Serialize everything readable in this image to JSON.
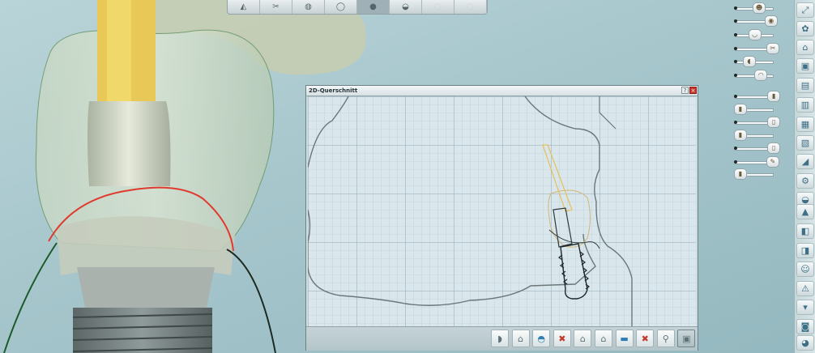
{
  "window": {
    "title": "2D-Querschnitt",
    "help_label": "?",
    "close_label": "×"
  },
  "top_toolbar": {
    "buttons": [
      {
        "name": "toolbar-view-1",
        "glyph": "◭"
      },
      {
        "name": "toolbar-view-2",
        "glyph": "✂"
      },
      {
        "name": "toolbar-view-3",
        "glyph": "◍"
      },
      {
        "name": "toolbar-view-4",
        "glyph": "◯"
      },
      {
        "name": "toolbar-view-5",
        "glyph": "●"
      },
      {
        "name": "toolbar-view-6",
        "glyph": "◒"
      },
      {
        "name": "toolbar-view-7",
        "glyph": "◌"
      },
      {
        "name": "toolbar-view-8",
        "glyph": "◌"
      }
    ]
  },
  "sliders": [
    {
      "name": "slider-1",
      "glyph": "☻",
      "level": 0.55
    },
    {
      "name": "slider-2",
      "glyph": "◉",
      "level": 0.9
    },
    {
      "name": "slider-3",
      "glyph": "◡",
      "level": 0.42
    },
    {
      "name": "slider-4",
      "glyph": "✂",
      "level": 0.95
    },
    {
      "name": "slider-5",
      "glyph": "◖",
      "level": 0.25
    },
    {
      "name": "slider-6",
      "glyph": "◠",
      "level": 0.6
    },
    {
      "name": "slider-7",
      "glyph": "▮",
      "level": 0.98
    },
    {
      "name": "slider-8",
      "glyph": "▮",
      "level": 0.0
    },
    {
      "name": "slider-9",
      "glyph": "▯",
      "level": 0.98
    },
    {
      "name": "slider-10",
      "glyph": "▮",
      "level": 0.0
    },
    {
      "name": "slider-11",
      "glyph": "▯",
      "level": 0.98
    },
    {
      "name": "slider-12",
      "glyph": "✎",
      "level": 0.95
    },
    {
      "name": "slider-13",
      "glyph": "▮",
      "level": 0.0
    }
  ],
  "tool_strip": [
    {
      "name": "strip-fit-button",
      "glyph": "⤢"
    },
    {
      "name": "strip-button-2",
      "glyph": "✿"
    },
    {
      "name": "strip-button-3",
      "glyph": "⌂"
    },
    {
      "name": "strip-button-4",
      "glyph": "▣"
    },
    {
      "name": "strip-button-5",
      "glyph": "▤"
    },
    {
      "name": "strip-button-6",
      "glyph": "▥"
    },
    {
      "name": "strip-button-7",
      "glyph": "▦"
    },
    {
      "name": "strip-button-8",
      "glyph": "▧"
    },
    {
      "name": "strip-button-9",
      "glyph": "◢"
    },
    {
      "name": "strip-button-10",
      "glyph": "⚙"
    },
    {
      "name": "strip-button-11",
      "glyph": "◒"
    },
    {
      "name": "strip-button-12",
      "glyph": "▲"
    },
    {
      "name": "strip-button-13",
      "glyph": "◧"
    },
    {
      "name": "strip-button-14",
      "glyph": "◨"
    },
    {
      "name": "strip-button-15",
      "glyph": "☺"
    },
    {
      "name": "strip-button-16",
      "glyph": "⚠"
    },
    {
      "name": "strip-button-17",
      "glyph": "▾"
    },
    {
      "name": "strip-button-18",
      "glyph": "◙"
    },
    {
      "name": "strip-button-19",
      "glyph": "◕"
    }
  ],
  "footer_buttons": [
    {
      "name": "footer-button-1",
      "glyph": "◗",
      "style": ""
    },
    {
      "name": "footer-button-2",
      "glyph": "⌂",
      "style": ""
    },
    {
      "name": "footer-button-3",
      "glyph": "◓",
      "style": "blue"
    },
    {
      "name": "footer-button-4",
      "glyph": "✖",
      "style": "red"
    },
    {
      "name": "footer-button-5",
      "glyph": "⌂",
      "style": ""
    },
    {
      "name": "footer-button-6",
      "glyph": "⌂",
      "style": ""
    },
    {
      "name": "footer-button-7",
      "glyph": "▬",
      "style": "blue"
    },
    {
      "name": "footer-button-8",
      "glyph": "✖",
      "style": "red"
    },
    {
      "name": "footer-button-9",
      "glyph": "⚲",
      "style": ""
    },
    {
      "name": "footer-button-10",
      "glyph": "▣",
      "style": ""
    }
  ],
  "colors": {
    "margin_line": "#e03a2e",
    "implant_axis": "#e6c15a",
    "gingiva_line": "#1c5a2a"
  }
}
